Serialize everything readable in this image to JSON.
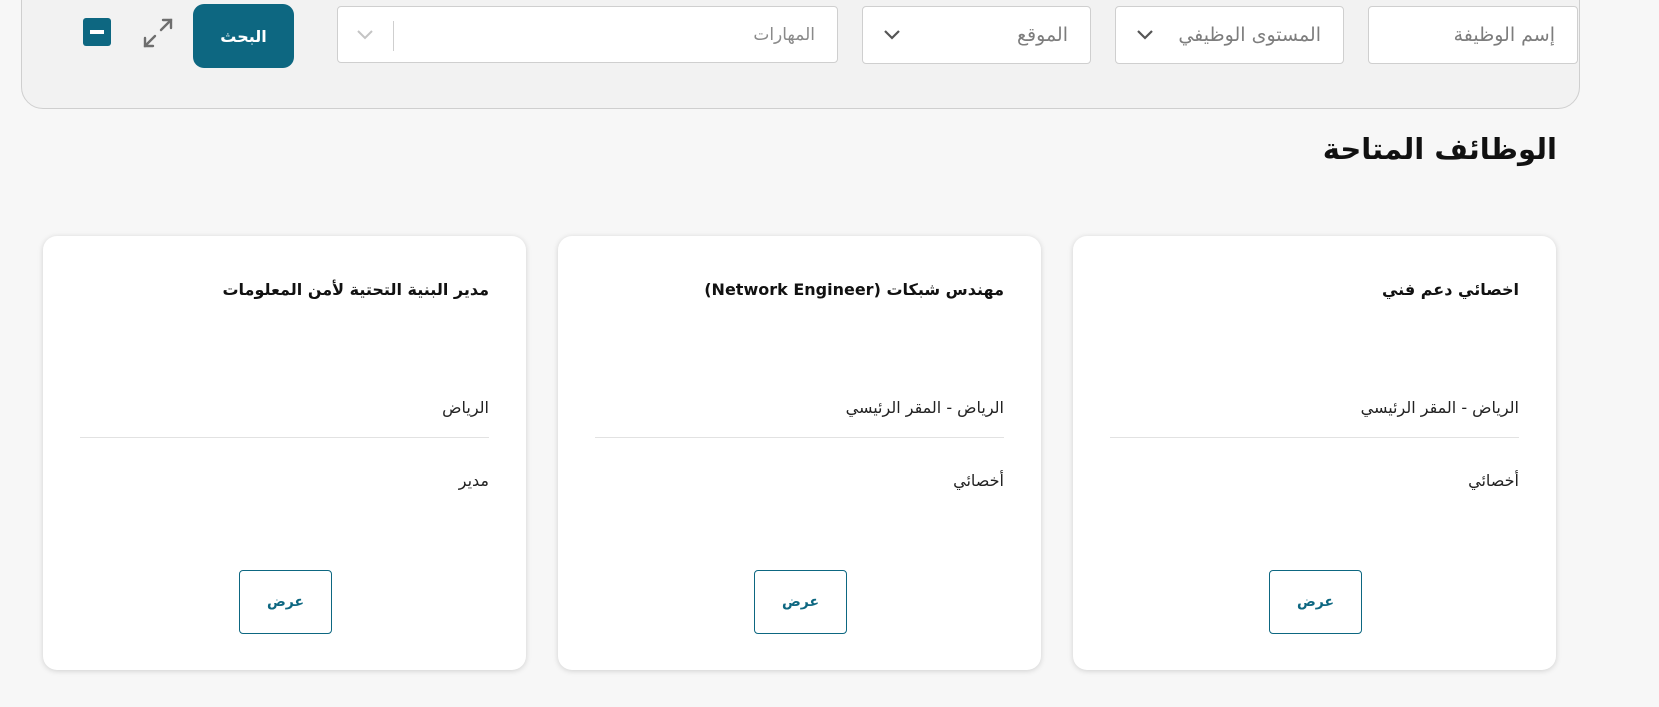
{
  "filters": {
    "job_name_placeholder": "إسم الوظيفة",
    "level_placeholder": "المستوى الوظيفي",
    "location_placeholder": "الموقع",
    "skills_placeholder": "المهارات",
    "search_label": "البحث",
    "icons": {
      "expand": "expand-icon",
      "collapse": "minus-square-icon",
      "dropdown": "chevron-down-icon"
    }
  },
  "section": {
    "title": "الوظائف المتاحة"
  },
  "jobs": [
    {
      "title": "اخصائي دعم فني",
      "location": "الرياض - المقر الرئيسي",
      "level": "أخصائي",
      "view_label": "عرض"
    },
    {
      "title": "مهندس شبكات (Network Engineer)",
      "location": "الرياض - المقر الرئيسي",
      "level": "أخصائي",
      "view_label": "عرض"
    },
    {
      "title": "مدير البنية التحتية لأمن المعلومات",
      "location": "الرياض",
      "level": "مدير",
      "view_label": "عرض"
    }
  ],
  "colors": {
    "accent": "#0d6781",
    "background": "#f7f7f7",
    "panel": "#f2f2f2"
  }
}
